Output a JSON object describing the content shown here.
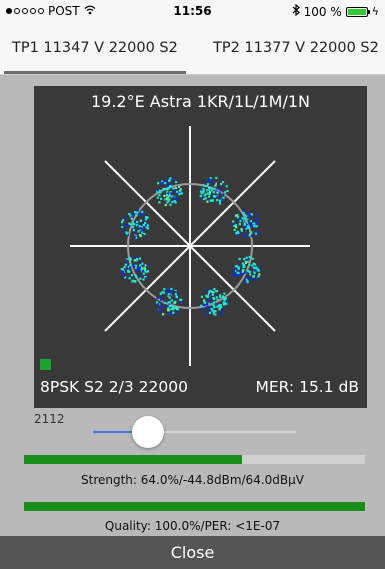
{
  "status_bar": {
    "carrier": "POST",
    "time": "11:56",
    "battery": "100 %",
    "battery_level": 1.0,
    "icons": [
      "wifi-icon",
      "bluetooth-icon",
      "battery-icon",
      "charging-icon"
    ]
  },
  "tabs": [
    {
      "label": "TP1 11347 V 22000 S2",
      "active": true
    },
    {
      "label": "TP2 11377 V 22000 S2",
      "active": false
    }
  ],
  "constellation": {
    "title": "19.2°E Astra 1KR/1L/1M/1N",
    "modulation": "8PSK S2 2/3 22000",
    "mer": "MER: 15.1 dB",
    "colors": {
      "panel": "#393939",
      "points": [
        "#1de9d6",
        "#0a2fd8",
        "#7af07a"
      ],
      "circle": "#9a9a9a",
      "lock": "#1aa533"
    }
  },
  "slider": {
    "value_label": "2112",
    "level": 0.27
  },
  "strength": {
    "label": "Strength: 64.0%/-44.8dBm/64.0dBµV",
    "level": 0.64,
    "color": "#1a8c1a"
  },
  "quality": {
    "label": "Quality: 100.0%/PER: <1E-07",
    "level": 1.0,
    "color": "#1a8c1a"
  },
  "close_label": "Close"
}
